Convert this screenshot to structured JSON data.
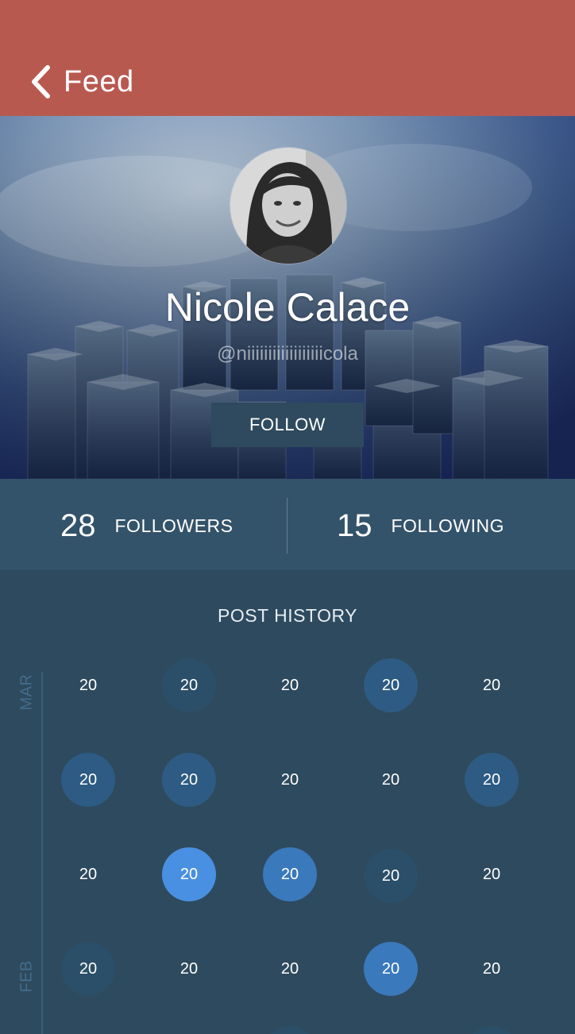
{
  "header": {
    "back_label": "Feed"
  },
  "profile": {
    "name": "Nicole Calace",
    "handle": "@niiiiiiiiiiiiiiiiiicola",
    "follow_label": "FOLLOW"
  },
  "stats": {
    "followers_count": "28",
    "followers_label": "FOLLOWERS",
    "following_count": "15",
    "following_label": "FOLLOWING"
  },
  "post_history": {
    "title": "POST HISTORY",
    "months": [
      "MAR",
      "FEB"
    ],
    "rows": [
      [
        {
          "value": "20",
          "level": 0
        },
        {
          "value": "20",
          "level": 1
        },
        {
          "value": "20",
          "level": 0
        },
        {
          "value": "20",
          "level": 2
        },
        {
          "value": "20",
          "level": 0
        }
      ],
      [
        {
          "value": "20",
          "level": 2
        },
        {
          "value": "20",
          "level": 2
        },
        {
          "value": "20",
          "level": 0
        },
        {
          "value": "20",
          "level": 0
        },
        {
          "value": "20",
          "level": 2
        }
      ],
      [
        {
          "value": "20",
          "level": 0
        },
        {
          "value": "20",
          "level": 4
        },
        {
          "value": "20",
          "level": 3
        },
        {
          "value": "20",
          "level": 1
        },
        {
          "value": "20",
          "level": 0
        }
      ],
      [
        {
          "value": "20",
          "level": 1
        },
        {
          "value": "20",
          "level": 0
        },
        {
          "value": "20",
          "level": 0
        },
        {
          "value": "20",
          "level": 3
        },
        {
          "value": "20",
          "level": 0
        }
      ]
    ]
  },
  "colors": {
    "header_bg": "#b85950",
    "stats_bg": "#33536a",
    "history_bg": "#2e4a5e",
    "follow_button_bg": "#2f4a5e",
    "activity_low": "#2b4f68",
    "activity_mid": "#2d5b83",
    "activity_high": "#3a79bc",
    "activity_max": "#4a90e2"
  },
  "icons": {
    "back": "chevron-left-icon"
  }
}
